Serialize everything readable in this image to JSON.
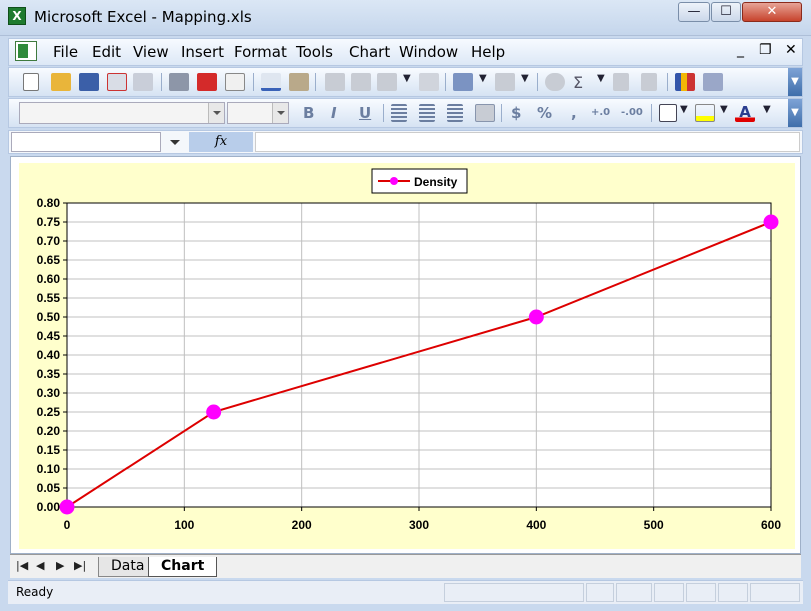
{
  "window": {
    "title": "Microsoft Excel - Mapping.xls",
    "app_icon_letter": "X"
  },
  "window_controls": {
    "minimize": "—",
    "maximize": "☐",
    "close": "✕"
  },
  "menu": {
    "items": [
      {
        "label": "File"
      },
      {
        "label": "Edit"
      },
      {
        "label": "View"
      },
      {
        "label": "Insert"
      },
      {
        "label": "Format"
      },
      {
        "label": "Tools"
      },
      {
        "label": "Chart"
      },
      {
        "label": "Window"
      },
      {
        "label": "Help"
      }
    ],
    "doc_controls": {
      "close": "✕",
      "restore": "❐",
      "minimize": "_"
    }
  },
  "toolbar_format": {
    "bold": "B",
    "italic": "I",
    "underline": "U",
    "currency": "$",
    "percent": "%",
    "comma": ",",
    "inc_decimal": "+.0",
    "dec_decimal": "-.00"
  },
  "formula_bar": {
    "fx_label": "fx",
    "name_box_value": "",
    "formula_value": ""
  },
  "sheet_tabs": [
    {
      "label": "Data",
      "active": false
    },
    {
      "label": "Chart",
      "active": true
    }
  ],
  "status": {
    "text": "Ready"
  },
  "chart_data": {
    "type": "line",
    "title": "",
    "xlabel": "",
    "ylabel": "",
    "x": [
      0,
      125,
      400,
      600
    ],
    "series": [
      {
        "name": "Density",
        "values": [
          0.0,
          0.25,
          0.5,
          0.75
        ],
        "color": "#dd0000",
        "marker_color": "#ff00ff"
      }
    ],
    "xlim": [
      0,
      600
    ],
    "ylim": [
      0,
      0.8
    ],
    "x_ticks": [
      "0",
      "100",
      "200",
      "300",
      "400",
      "500",
      "600"
    ],
    "y_ticks": [
      "0.00",
      "0.05",
      "0.10",
      "0.15",
      "0.20",
      "0.25",
      "0.30",
      "0.35",
      "0.40",
      "0.45",
      "0.50",
      "0.55",
      "0.60",
      "0.65",
      "0.70",
      "0.75",
      "0.80"
    ],
    "grid": true,
    "legend_position": "top-center",
    "plot_background": "#ffffff",
    "chart_background": "#ffffcc"
  }
}
